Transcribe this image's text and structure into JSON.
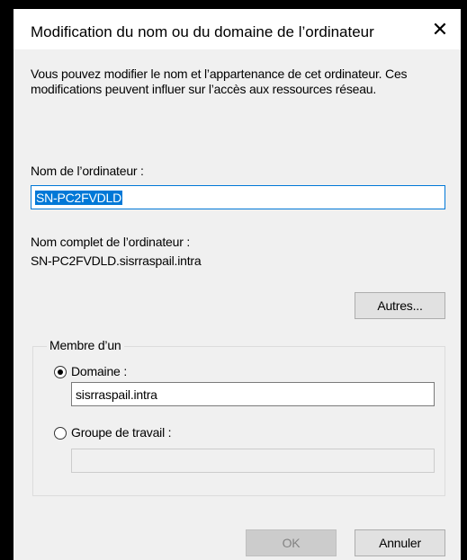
{
  "dialog": {
    "title": "Modification du nom ou du domaine de l’ordinateur",
    "close_glyph": "✕",
    "description": "Vous pouvez modifier le nom et l’appartenance de cet ordinateur. Ces modifications peuvent influer sur l’accès aux ressources réseau."
  },
  "computer_name": {
    "label": "Nom de l’ordinateur :",
    "value": "SN-PC2FVDLD"
  },
  "full_name": {
    "label": "Nom complet de l’ordinateur :",
    "value": "SN-PC2FVDLD.sisrraspail.intra"
  },
  "more_button": "Autres...",
  "member_of": {
    "legend": "Membre d’un",
    "domain": {
      "label": "Domaine :",
      "value": "sisrraspail.intra",
      "selected": true
    },
    "workgroup": {
      "label": "Groupe de travail :",
      "value": "",
      "selected": false
    }
  },
  "footer": {
    "ok": "OK",
    "cancel": "Annuler"
  },
  "colors": {
    "accent": "#0078d7",
    "dialog_bg": "#f0f0f0",
    "frame": "#000000"
  }
}
